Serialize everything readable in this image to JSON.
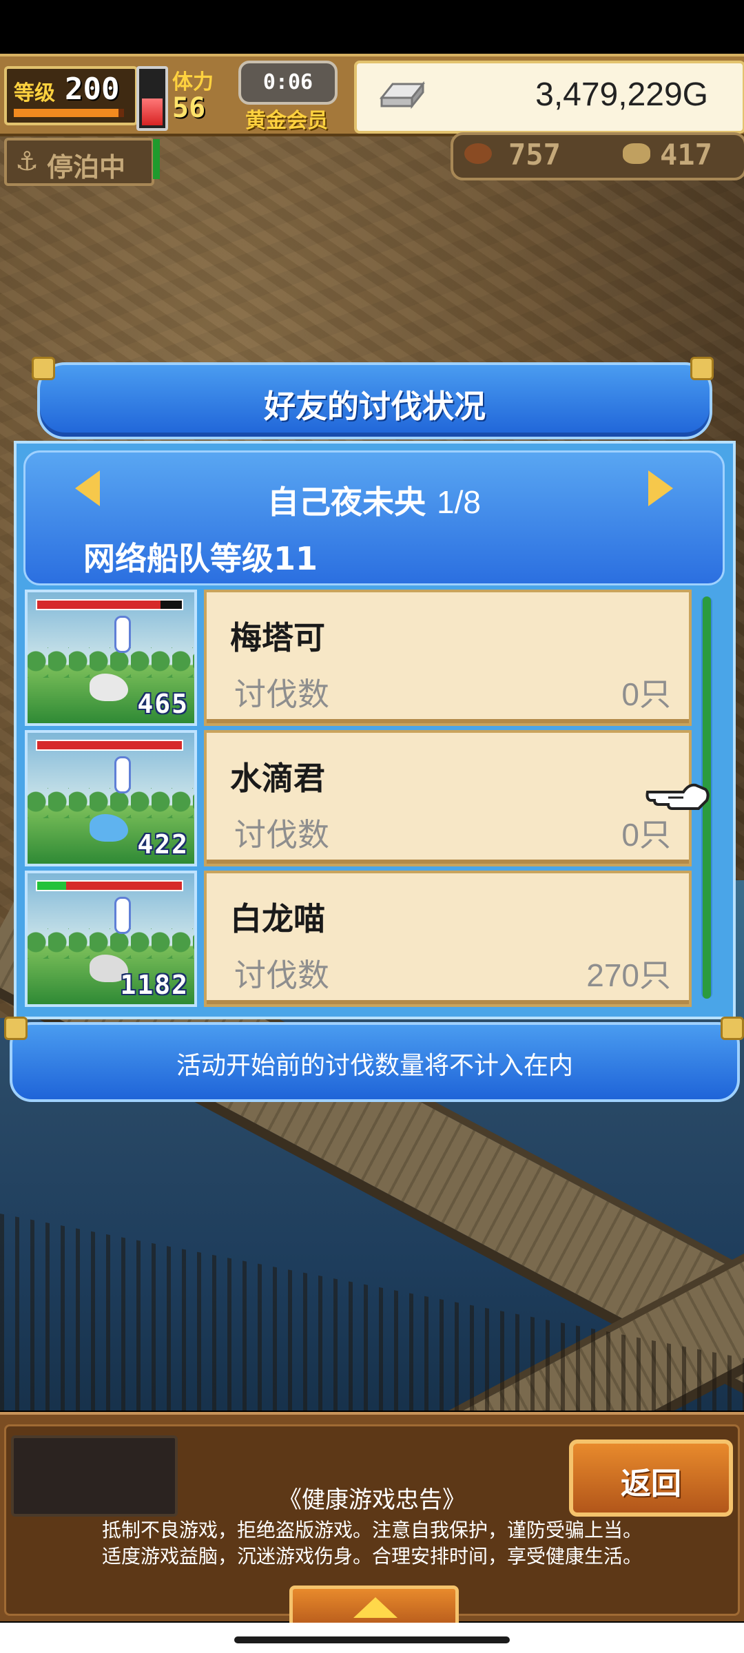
{
  "hud": {
    "level_label": "等级",
    "level_value": "200",
    "level_progress": 0.95,
    "stamina_label": "体力",
    "stamina_value": "56",
    "stamina_level": 0.55,
    "timer": "0:06",
    "vip_label": "黄金会员",
    "gold_value": "3,479,229G"
  },
  "status": {
    "moored_label": "停泊中",
    "food_value": "757",
    "medal_value": "417"
  },
  "dialog": {
    "title": "好友的讨伐状况",
    "friend_name": "自己夜未央",
    "friend_page": "1/8",
    "fleet_level": "网络船队等级11",
    "kill_label": "讨伐数",
    "notice": "活动开始前的讨伐数量将不计入在内",
    "monsters": [
      {
        "name": "梅塔可",
        "kill_count": "0只",
        "number": "465",
        "hp": 0.85,
        "monster_color": "#e8e8e8"
      },
      {
        "name": "水滴君",
        "kill_count": "0只",
        "number": "422",
        "hp": 1.0,
        "monster_color": "#5fb3ef"
      },
      {
        "name": "白龙喵",
        "kill_count": "270只",
        "number": "1182",
        "hp": 1.0,
        "monster_color": "#dcdcdc"
      }
    ]
  },
  "bottom": {
    "back_label": "返回",
    "health_title": "《健康游戏忠告》",
    "health_line1": "抵制不良游戏，拒绝盗版游戏。注意自我保护，谨防受骗上当。",
    "health_line2": "适度游戏益脑，沉迷游戏伤身。合理安排时间，享受健康生活。"
  },
  "colors": {
    "panel_blue": "#4aa5e8",
    "banner_blue": "#1f64d8",
    "card_cream": "#f7e7c6",
    "accent_gold": "#e9c45b"
  }
}
